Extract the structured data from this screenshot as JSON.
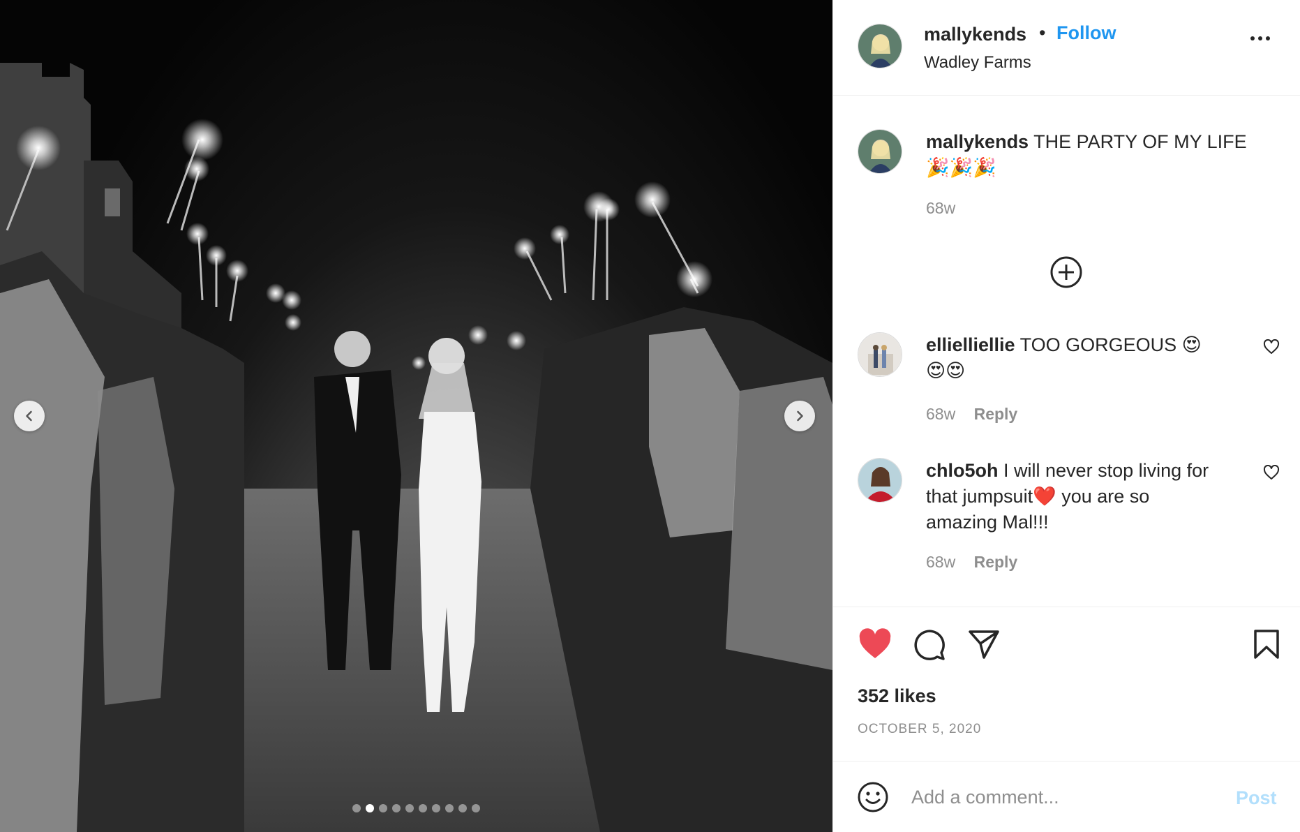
{
  "post": {
    "image_alt": "Wedding couple exit under sparklers",
    "carousel": {
      "total": 10,
      "active_index": 1
    }
  },
  "header": {
    "username": "mallykends",
    "separator": "•",
    "follow_label": "Follow",
    "location": "Wadley Farms"
  },
  "caption": {
    "username": "mallykends",
    "text": "THE PARTY OF MY LIFE",
    "emoji": "🎉🎉🎉",
    "time": "68w"
  },
  "comments": [
    {
      "username": "ellielliellie",
      "text": "TOO GORGEOUS 😍",
      "text2": "😍😍",
      "time": "68w",
      "reply_label": "Reply"
    },
    {
      "username": "chlo5oh",
      "text": "I will never stop living for",
      "text2": "that jumpsuit❤️ you are so",
      "text3": "amazing Mal!!!",
      "time": "68w",
      "reply_label": "Reply"
    }
  ],
  "stats": {
    "likes": "352 likes",
    "date": "OCTOBER 5, 2020",
    "liked": true
  },
  "add_comment": {
    "placeholder": "Add a comment...",
    "post_label": "Post"
  },
  "colors": {
    "accent": "#1f96f0",
    "like": "#ed4956",
    "post_disabled": "#b2dffc",
    "muted": "#8e8e8e"
  },
  "icons": {
    "options": "more-horizontal-icon",
    "load_more": "plus-circle-icon",
    "like": "heart-filled-icon",
    "comment": "comment-icon",
    "share": "paper-plane-icon",
    "save": "bookmark-icon",
    "emoji": "smiley-icon",
    "prev": "chevron-left-icon",
    "next": "chevron-right-icon"
  }
}
